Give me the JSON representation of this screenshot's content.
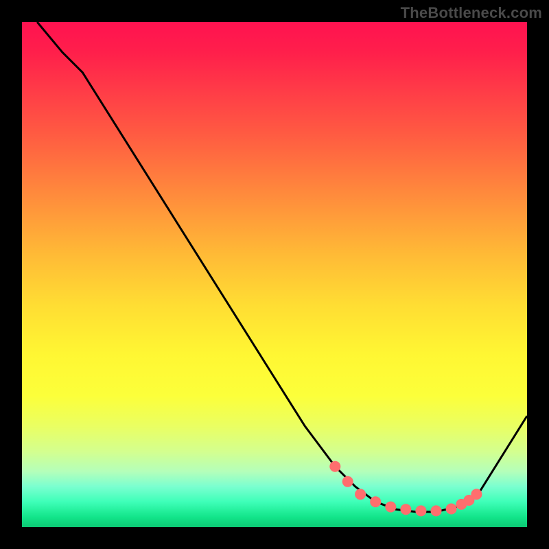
{
  "watermark": "TheBottleneck.com",
  "chart_data": {
    "type": "line",
    "title": "",
    "xlabel": "",
    "ylabel": "",
    "xlim": [
      0,
      100
    ],
    "ylim": [
      0,
      100
    ],
    "grid": false,
    "legend": false,
    "series": [
      {
        "name": "curve",
        "x": [
          3,
          8,
          12,
          56,
          62,
          66,
          70,
          74,
          78,
          82,
          86,
          90,
          100
        ],
        "y": [
          100,
          94,
          90,
          20,
          12,
          8,
          5,
          3.5,
          3,
          3,
          4,
          6,
          22
        ]
      }
    ],
    "markers": {
      "name": "dots",
      "x": [
        62,
        64.5,
        67,
        70,
        73,
        76,
        79,
        82,
        85,
        87,
        88.5,
        90
      ],
      "y": [
        12,
        9,
        6.5,
        5,
        4,
        3.5,
        3.2,
        3.2,
        3.6,
        4.5,
        5.3,
        6.5
      ],
      "color": "#ff6e6e",
      "r": 8
    },
    "gradient_stops": [
      {
        "pos": 0,
        "color": "#ff1250"
      },
      {
        "pos": 14,
        "color": "#ff3d47"
      },
      {
        "pos": 30,
        "color": "#ff7a3e"
      },
      {
        "pos": 46,
        "color": "#ffba36"
      },
      {
        "pos": 66,
        "color": "#fff733"
      },
      {
        "pos": 85,
        "color": "#d4ff8e"
      },
      {
        "pos": 95,
        "color": "#3effb8"
      },
      {
        "pos": 100,
        "color": "#0cc974"
      }
    ]
  }
}
